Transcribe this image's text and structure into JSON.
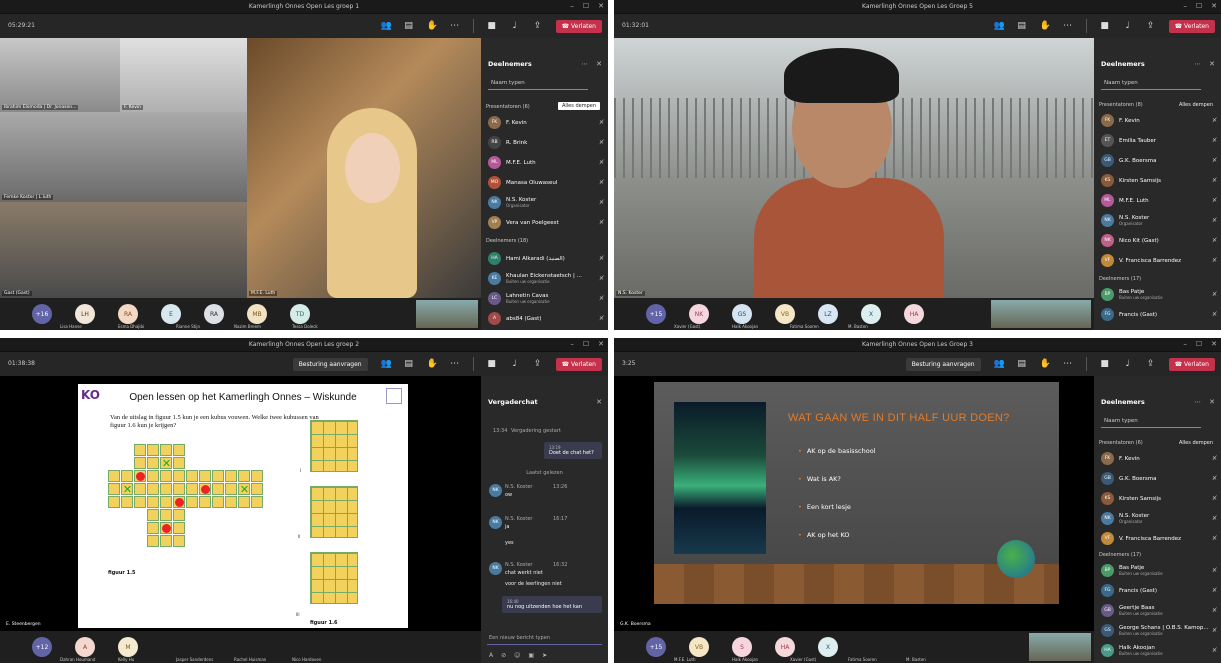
{
  "w1": {
    "title": "Kamerlingh Onnes Open Les groep 1",
    "timer": "05:29:21",
    "leave": "Verlaten",
    "panel_title": "Deelnemers",
    "search": "Naam typen",
    "presenters": "Presentatoren (6)",
    "mute_all": "Alles dempen",
    "people": [
      {
        "ini": "FK",
        "name": "F. Kevin",
        "sub": "",
        "color": "#8a6a4a"
      },
      {
        "ini": "RB",
        "name": "R. Brink",
        "sub": "",
        "color": "#444"
      },
      {
        "ini": "ML",
        "name": "M.F.E. Luth",
        "sub": "",
        "color": "#b45a9a"
      },
      {
        "ini": "MO",
        "name": "Manasa Oluwaseul",
        "sub": "",
        "color": "#b0523a"
      },
      {
        "ini": "NK",
        "name": "N.S. Koster",
        "sub": "Organisator",
        "color": "#4a7aa0"
      },
      {
        "ini": "VP",
        "name": "Vera van Poelgeest",
        "sub": "",
        "color": "#a08050"
      }
    ],
    "attendees": "Deelnemers (18)",
    "people2": [
      {
        "ini": "HA",
        "name": "Hami Alkaradi (الصنبد)",
        "sub": "",
        "color": "#2f7f6a"
      },
      {
        "ini": "KE",
        "name": "Khaulan Eickenstaetsch | ...",
        "sub": "Buiten uw organisatie",
        "color": "#4a7aa0"
      },
      {
        "ini": "LC",
        "name": "Lahnetin Cavas",
        "sub": "Buiten uw organisatie",
        "color": "#6a5a8a"
      },
      {
        "ini": "A",
        "name": "abs84 (Gast)",
        "sub": "",
        "color": "#a04a4a"
      }
    ],
    "tiles": [
      "Ibrahim Elomoda | Dr. Jonasen...",
      "F. Kevin",
      "Femke Koster | L.luth",
      "Gast (Gast)",
      "M.F.E. Luth"
    ],
    "bottom": [
      {
        "ini": "+16",
        "color": "#6264a7",
        "fg": "#fff"
      },
      {
        "ini": "LH",
        "color": "#f1e6d8",
        "fg": "#5a3a1a"
      },
      {
        "ini": "RA",
        "color": "#f3d9c4",
        "fg": "#8a4a2a"
      },
      {
        "ini": "E",
        "color": "#d8e8ef",
        "fg": "#2a5a6a"
      },
      {
        "ini": "RA",
        "color": "#dde0e4",
        "fg": "#333"
      },
      {
        "ini": "MB",
        "color": "#f1e2c4",
        "fg": "#7a5a1a"
      },
      {
        "ini": "TD",
        "color": "#d4ece8",
        "fg": "#2a6a5a"
      }
    ],
    "bottom_labels": [
      "Lisa Hanse",
      "Esma Dhajibi",
      "Rianne Stijn",
      "Nazim Breem",
      "Tessa Doleck"
    ]
  },
  "w2": {
    "title": "Kamerlingh Onnes Open Les Groep 5",
    "timer": "01:32:01",
    "leave": "Verlaten",
    "panel_title": "Deelnemers",
    "search": "Naam typen",
    "presenters": "Presentatoren (8)",
    "mute_all": "Alles dempen",
    "people": [
      {
        "ini": "FK",
        "name": "F. Kevin",
        "sub": "",
        "color": "#8a6a4a"
      },
      {
        "ini": "ET",
        "name": "Emilia Tauber",
        "sub": "",
        "color": "#555"
      },
      {
        "ini": "GB",
        "name": "G.K. Boersma",
        "sub": "",
        "color": "#3a5a7a"
      },
      {
        "ini": "KS",
        "name": "Kirsten Samsijs",
        "sub": "",
        "color": "#8a5a3a"
      },
      {
        "ini": "ML",
        "name": "M.F.E. Luth",
        "sub": "",
        "color": "#b45a9a"
      },
      {
        "ini": "NK",
        "name": "N.S. Koster",
        "sub": "Organisator",
        "color": "#4a7aa0"
      },
      {
        "ini": "NK",
        "name": "Nico Kit (Gast)",
        "sub": "",
        "color": "#c0608a"
      },
      {
        "ini": "VF",
        "name": "V. Francisca Barrendez",
        "sub": "",
        "color": "#c08a3a"
      }
    ],
    "attendees": "Deelnemers (17)",
    "people2": [
      {
        "ini": "BP",
        "name": "Bas Patje",
        "sub": "Buiten uw organisatie",
        "color": "#4a9a6a"
      },
      {
        "ini": "FG",
        "name": "Francis (Gast)",
        "sub": "",
        "color": "#3a6a8a"
      }
    ],
    "tile_name": "N.S. Koster",
    "bottom": [
      {
        "ini": "+15",
        "color": "#6264a7",
        "fg": "#fff"
      },
      {
        "ini": "NK",
        "color": "#f6d6de",
        "fg": "#a03a5a"
      },
      {
        "ini": "GS",
        "color": "#d4e4f0",
        "fg": "#2a4a7a"
      },
      {
        "ini": "VB",
        "color": "#f6e6c8",
        "fg": "#8a6a1a"
      },
      {
        "ini": "LZ",
        "color": "#d8e6f4",
        "fg": "#2a4a7a"
      },
      {
        "ini": "X",
        "color": "#dceef0",
        "fg": "#2a5a6a"
      },
      {
        "ini": "HA",
        "color": "#f4d8dc",
        "fg": "#a03a4a"
      }
    ],
    "bottom_labels": [
      "Xavier (Gast)",
      "Halk Akoojan",
      "Fatima Sooren",
      "M. Basten"
    ]
  },
  "w3": {
    "title": "Kamerlingh Onnes Open Les groep 2",
    "timer": "01:38:38",
    "leave": "Verlaten",
    "request": "Besturing aanvragen",
    "slide_title": "Open lessen op het Kamerlingh Onnes – Wiskunde",
    "question": "Van de uitslag in figuur 1.5 kun je een kubus vouwen. Welke twee kubussen van figuur 1.6 kun je krijgen?",
    "fig1": "figuur 1.5",
    "fig2": "figuur 1.6",
    "lbl1": "I",
    "lbl2": "II",
    "lbl3": "III",
    "logo": "KO",
    "chat_title": "Vergaderchat",
    "meeting_started": "Vergadering gestart",
    "meeting_time": "13:34",
    "msg_time": "13:19",
    "msg_self": "Doet de chat het?",
    "last_read": "Laatst gelezen",
    "chats": [
      {
        "ini": "NK",
        "name": "N.S. Koster",
        "time": "13:26",
        "text": "ow"
      },
      {
        "ini": "NK",
        "name": "N.S. Koster",
        "time": "16:17",
        "text": "ja"
      },
      {
        "ini": "NK",
        "name": "N.S. Koster",
        "time": "16:32",
        "text": "chat werkt niet"
      }
    ],
    "yes": "yes",
    "reply": "voor de leerlingen niet",
    "me2_time": "16:40",
    "me2": "nu nog uitzenden hoe het kan",
    "compose": "Een nieuw bericht typen",
    "presenter": "E. Steenbergen",
    "bottom": [
      {
        "ini": "+12",
        "color": "#6264a7",
        "fg": "#fff"
      },
      {
        "ini": "A",
        "color": "#f4d8d0",
        "fg": "#a03a2a"
      },
      {
        "ini": "M",
        "color": "#f4ead0",
        "fg": "#7a5a1a"
      }
    ],
    "bottom_labels": [
      "Dahran Houmand",
      "Kelly Hu",
      "Jasper Sanderdens",
      "Rachel Huisman",
      "Nico Hardoven"
    ]
  },
  "w4": {
    "title": "Kamerlingh Onnes Open Les Groep 3",
    "timer": "3:25",
    "leave": "Verlaten",
    "request": "Besturing aanvragen",
    "panel_title": "Deelnemers",
    "search": "Naam typen",
    "presenters": "Presentatoren (6)",
    "mute_all": "Alles dempen",
    "people": [
      {
        "ini": "FK",
        "name": "F. Kevin",
        "sub": "",
        "color": "#8a6a4a"
      },
      {
        "ini": "GB",
        "name": "G.K. Boersma",
        "sub": "",
        "color": "#3a5a7a"
      },
      {
        "ini": "KS",
        "name": "Kirsten Samsijs",
        "sub": "",
        "color": "#8a5a3a"
      },
      {
        "ini": "NK",
        "name": "N.S. Koster",
        "sub": "Organisator",
        "color": "#4a7aa0"
      },
      {
        "ini": "VF",
        "name": "V. Francisca Barrendez",
        "sub": "",
        "color": "#c08a3a"
      }
    ],
    "attendees": "Deelnemers (17)",
    "people2": [
      {
        "ini": "BP",
        "name": "Bas Patje",
        "sub": "Buiten uw organisatie",
        "color": "#4a9a6a"
      },
      {
        "ini": "FG",
        "name": "Francis (Gast)",
        "sub": "",
        "color": "#3a6a8a"
      },
      {
        "ini": "GB",
        "name": "Geertje Baas",
        "sub": "Buiten uw organisatie",
        "color": "#6a5a8a"
      },
      {
        "ini": "GS",
        "name": "George Schans | O.B.S. Kamop...",
        "sub": "Buiten uw organisatie",
        "color": "#3a5a7a"
      },
      {
        "ini": "HA",
        "name": "Halk Akoojan",
        "sub": "Buiten uw organisatie",
        "color": "#4a9a8a"
      }
    ],
    "ppt_title": "WAT GAAN WE IN DIT HALF UUR DOEN?",
    "bullets": [
      "AK op de basisschool",
      "Wat is AK?",
      "Een kort lesje",
      "AK op het KO"
    ],
    "presenter": "G.K. Boersma",
    "bottom": [
      {
        "ini": "+15",
        "color": "#6264a7",
        "fg": "#fff"
      },
      {
        "ini": "VB",
        "color": "#f6e6c8",
        "fg": "#8a6a1a"
      },
      {
        "ini": "S",
        "color": "#f6d6de",
        "fg": "#a03a5a"
      },
      {
        "ini": "HA",
        "color": "#f4d8dc",
        "fg": "#a03a4a"
      },
      {
        "ini": "X",
        "color": "#dceef0",
        "fg": "#2a5a6a"
      }
    ],
    "bottom_labels": [
      "M.F.E. Luth",
      "Halk Akoojan",
      "Xavier (Gast)",
      "Fatima Sooren",
      "M. Basten"
    ]
  }
}
